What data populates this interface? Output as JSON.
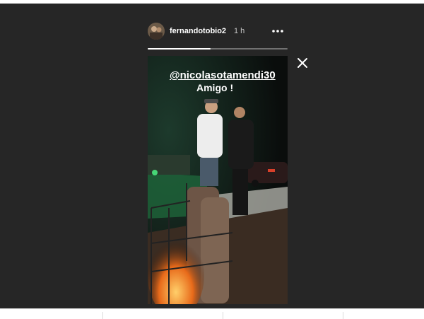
{
  "story": {
    "username": "fernandotobio2",
    "time_ago": "1 h",
    "mention": "@nicolasotamendi30",
    "caption": "Amigo !",
    "progress": 0.45
  },
  "icons": {
    "more": "more-options-icon",
    "close": "close-icon"
  },
  "colors": {
    "viewer_background": "#262626",
    "text": "#ffffff"
  }
}
